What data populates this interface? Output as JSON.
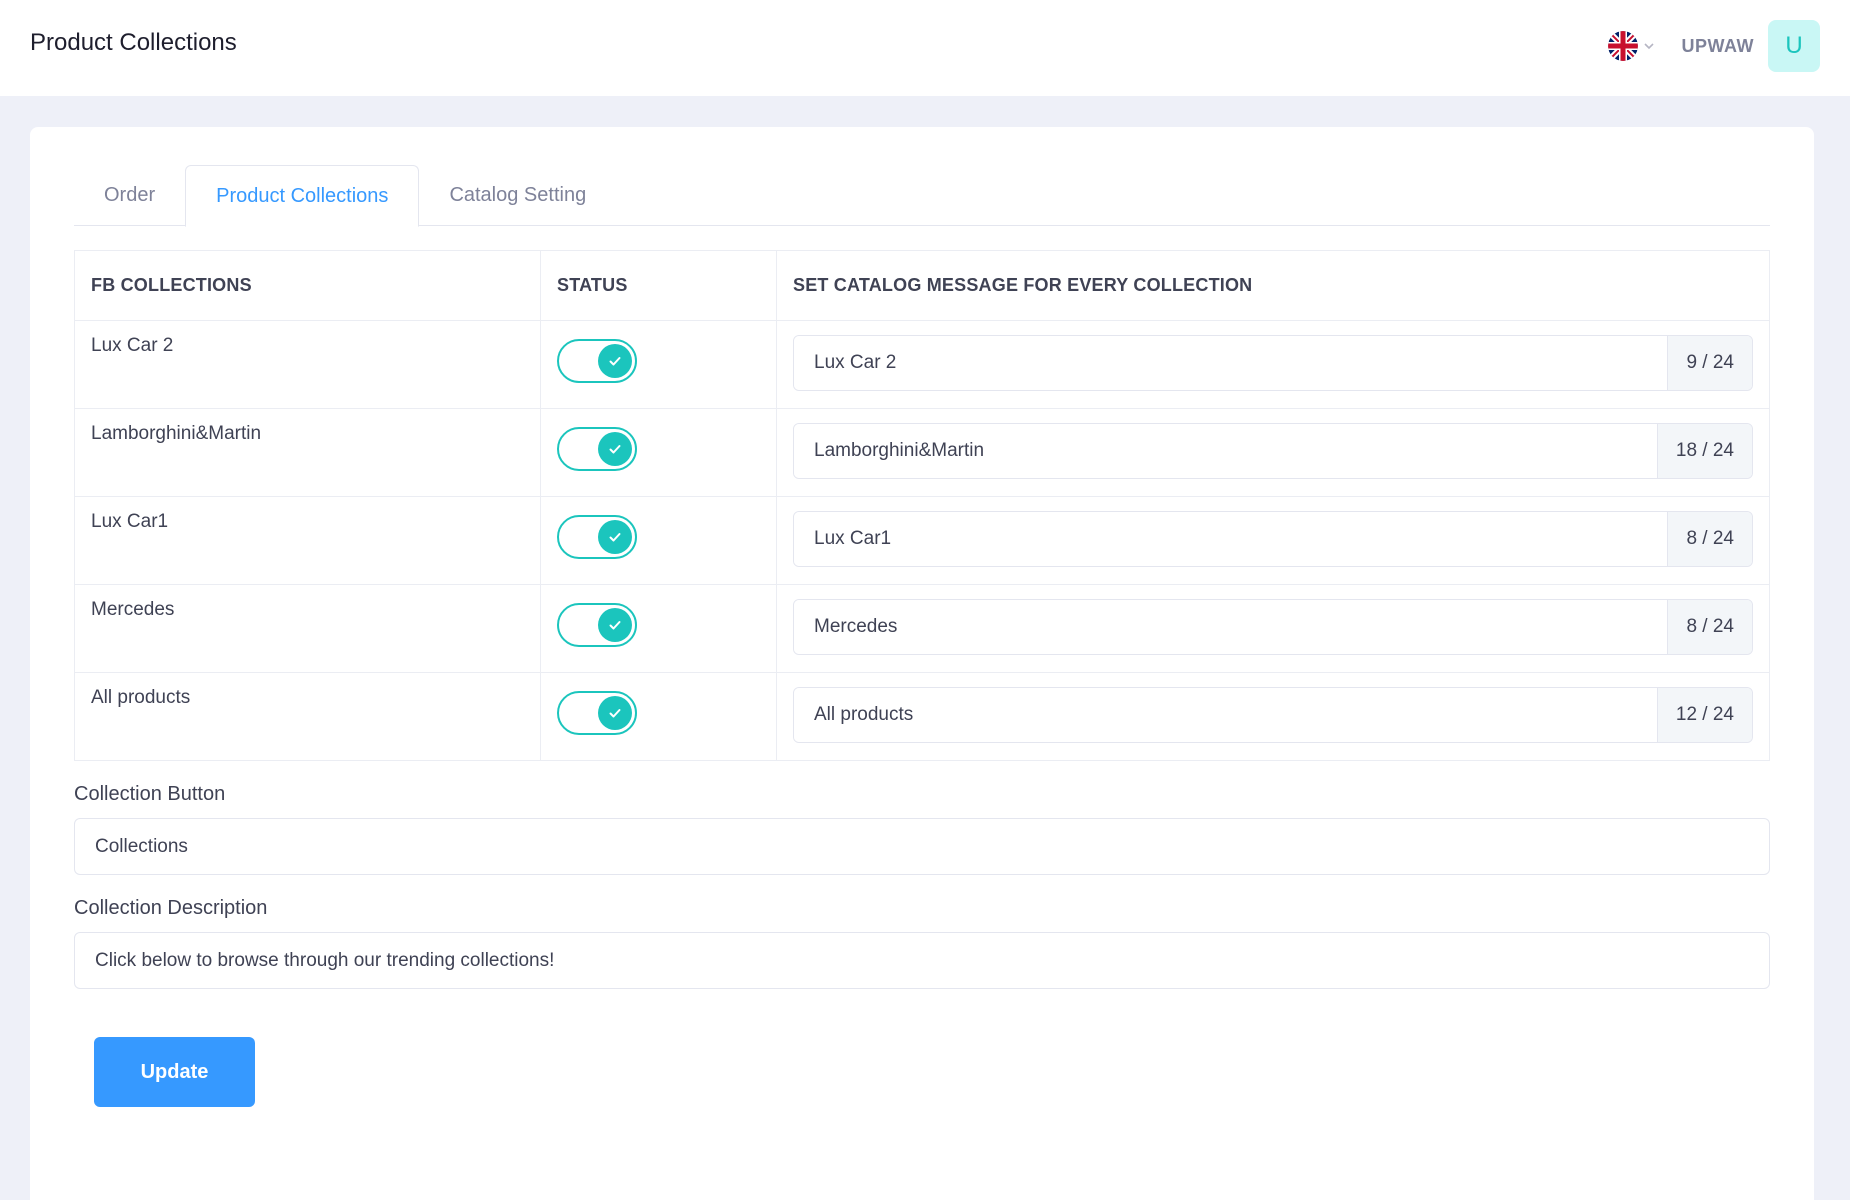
{
  "header": {
    "title": "Product Collections",
    "username": "UPWAW",
    "avatar_letter": "U"
  },
  "tabs": [
    {
      "label": "Order",
      "active": false
    },
    {
      "label": "Product Collections",
      "active": true
    },
    {
      "label": "Catalog Setting",
      "active": false
    }
  ],
  "table": {
    "headers": [
      "FB COLLECTIONS",
      "STATUS",
      "SET CATALOG MESSAGE FOR EVERY COLLECTION"
    ],
    "rows": [
      {
        "name": "Lux Car 2",
        "status": true,
        "message": "Lux Car 2",
        "count": "9 / 24"
      },
      {
        "name": "Lamborghini&Martin",
        "status": true,
        "message": "Lamborghini&Martin",
        "count": "18 / 24"
      },
      {
        "name": "Lux Car1",
        "status": true,
        "message": "Lux Car1",
        "count": "8 / 24"
      },
      {
        "name": "Mercedes",
        "status": true,
        "message": "Mercedes",
        "count": "8 / 24"
      },
      {
        "name": "All products",
        "status": true,
        "message": "All products",
        "count": "12 / 24"
      }
    ]
  },
  "form": {
    "button_label": "Collection Button",
    "button_value": "Collections",
    "description_label": "Collection Description",
    "description_value": "Click below to browse through our trending collections!",
    "submit_label": "Update"
  },
  "colors": {
    "accent": "#3699ff",
    "toggle_on": "#1bc5bd",
    "avatar_bg": "#c9f7f5"
  }
}
